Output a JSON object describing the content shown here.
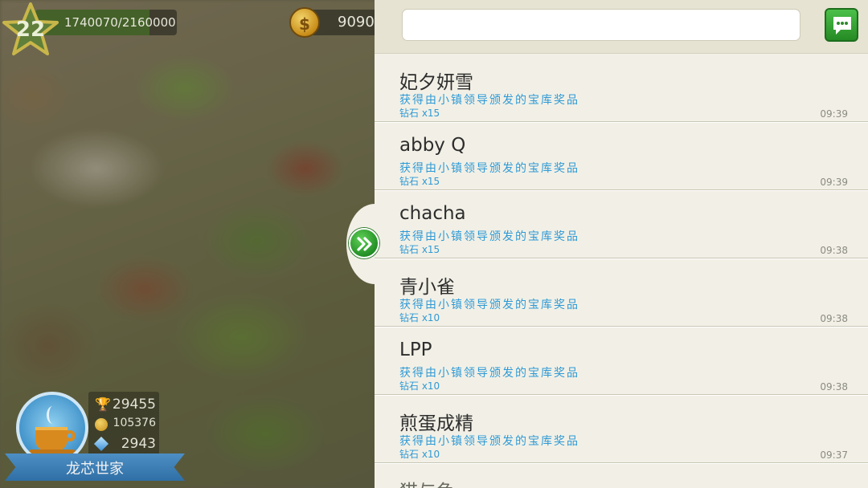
{
  "hud": {
    "level": "22",
    "xp_text": "1740070/2160000",
    "xp_progress": 0.8056,
    "coins": "9090"
  },
  "town": {
    "name": "龙芯世家",
    "trophies": "29455",
    "coins": "105376",
    "gems": "2943"
  },
  "search": {
    "value": "",
    "placeholder": ""
  },
  "messages": [
    {
      "sender": "妃夕妍雪",
      "text": "获得由小镇领导颁发的宝库奖品",
      "reward": "钻石 x15",
      "time": "09:39"
    },
    {
      "sender": "abby Q",
      "text": "获得由小镇领导颁发的宝库奖品",
      "reward": "钻石 x15",
      "time": "09:39"
    },
    {
      "sender": "chacha",
      "text": "获得由小镇领导颁发的宝库奖品",
      "reward": "钻石 x15",
      "time": "09:38"
    },
    {
      "sender": "青小雀",
      "text": "获得由小镇领导颁发的宝库奖品",
      "reward": "钻石 x10",
      "time": "09:38"
    },
    {
      "sender": "LPP",
      "text": "获得由小镇领导颁发的宝库奖品",
      "reward": "钻石 x10",
      "time": "09:38"
    },
    {
      "sender": "煎蛋成精",
      "text": "获得由小镇领导颁发的宝库奖品",
      "reward": "钻石 x10",
      "time": "09:37"
    },
    {
      "sender": "猫与鱼",
      "text": "",
      "reward": "",
      "time": ""
    }
  ],
  "colors": {
    "panel_bg": "#f2f0e6",
    "accent_text": "#2f9ad6",
    "green_button": "#3aa63a"
  },
  "icons": {
    "chat": "chat-bubble-icon",
    "collapse": "double-chevron-right-icon",
    "level": "star-icon",
    "coin": "coin-icon",
    "trophy": "trophy-icon",
    "gem": "gem-icon"
  }
}
